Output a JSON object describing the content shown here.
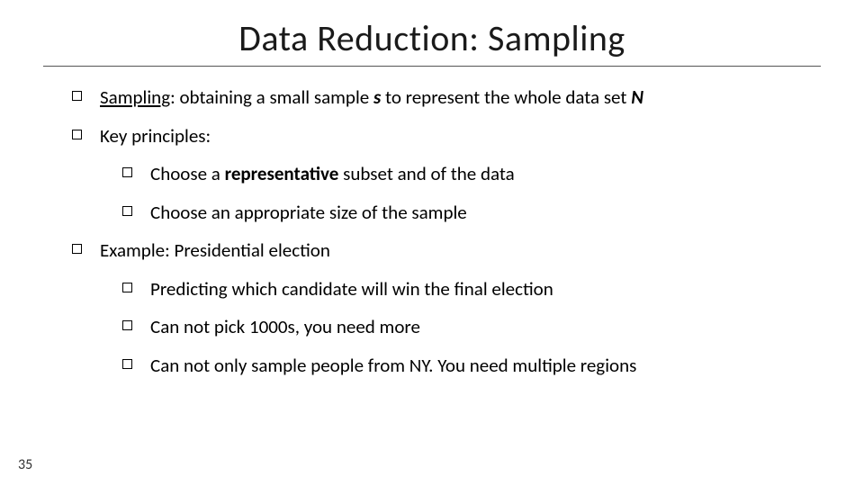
{
  "slide": {
    "title": "Data Reduction: Sampling",
    "pageNumber": "35",
    "b1": {
      "prefix": "Sampling",
      "middle": ": obtaining a small sample ",
      "s": "s",
      "after_s": " to represent the whole data set ",
      "N": "N"
    },
    "b2": "Key principles:",
    "b2a_pre": "Choose a ",
    "b2a_bold": "representative",
    "b2a_post": " subset and of the data",
    "b2b": "Choose an appropriate size of the sample",
    "b3": "Example: Presidential election",
    "b3a": "Predicting which candidate will win the final election",
    "b3b": "Can not pick 1000s, you need more",
    "b3c": "Can not only sample people from NY.  You need multiple regions"
  }
}
